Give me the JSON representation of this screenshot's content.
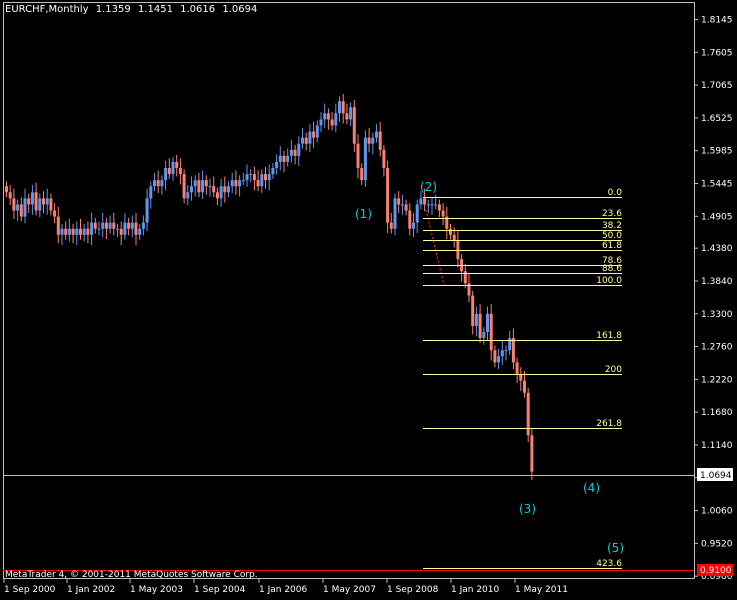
{
  "header": {
    "symbol_timeframe": "EURCHF,Monthly",
    "open": "1.1359",
    "high": "1.1451",
    "low": "1.0616",
    "close": "1.0694"
  },
  "copyright": "MetaTrader 4, © 2001-2011 MetaQuotes Software Corp.",
  "colors": {
    "background": "#000000",
    "bull_candle": "#6495ED",
    "bear_candle": "#FA8072",
    "fibo_line": "#FFFF99",
    "fibo_text": "#FFFF99",
    "wave_labels": "#00CED1",
    "price_marker_bg": "#FFFFFF",
    "alert_marker_bg": "#FF0000",
    "axis": "#C0C0C0"
  },
  "price_axis": {
    "ticks": [
      "1.8145",
      "1.7605",
      "1.7065",
      "1.6525",
      "1.5985",
      "1.5445",
      "1.4905",
      "1.4380",
      "1.3840",
      "1.3300",
      "1.2760",
      "1.2220",
      "1.1680",
      "1.1140",
      "1.0600",
      "1.0060",
      "0.9520",
      "0.8980"
    ],
    "current_price_label": "1.0694",
    "alert_price_label": "0.9100"
  },
  "time_axis": {
    "labels": [
      "1 Sep 2000",
      "1 Jan 2002",
      "1 May 2003",
      "1 Sep 2004",
      "1 Jan 2006",
      "1 May 2007",
      "1 Sep 2008",
      "1 Jan 2010",
      "1 May 2011"
    ]
  },
  "fibonacci": {
    "levels": [
      "0.0",
      "23.6",
      "38.2",
      "50.0",
      "61.8",
      "78.6",
      "88.6",
      "100.0",
      "161.8",
      "200",
      "261.8",
      "423.6"
    ]
  },
  "waves": {
    "labels": [
      "(1)",
      "(2)",
      "(3)",
      "(4)",
      "(5)"
    ]
  },
  "chart_data": {
    "type": "candlestick",
    "title": "EURCHF,Monthly",
    "ylim": [
      0.895,
      1.84
    ],
    "candles_close": [
      1.53,
      1.52,
      1.5,
      1.51,
      1.49,
      1.52,
      1.51,
      1.53,
      1.5,
      1.52,
      1.51,
      1.52,
      1.5,
      1.49,
      1.46,
      1.47,
      1.46,
      1.47,
      1.46,
      1.47,
      1.46,
      1.47,
      1.46,
      1.48,
      1.47,
      1.47,
      1.48,
      1.47,
      1.48,
      1.47,
      1.47,
      1.46,
      1.48,
      1.47,
      1.48,
      1.46,
      1.47,
      1.48,
      1.52,
      1.54,
      1.55,
      1.54,
      1.55,
      1.57,
      1.56,
      1.58,
      1.57,
      1.56,
      1.52,
      1.53,
      1.54,
      1.55,
      1.53,
      1.55,
      1.54,
      1.54,
      1.53,
      1.52,
      1.54,
      1.53,
      1.54,
      1.55,
      1.54,
      1.55,
      1.55,
      1.56,
      1.56,
      1.55,
      1.54,
      1.56,
      1.55,
      1.56,
      1.57,
      1.58,
      1.59,
      1.58,
      1.59,
      1.6,
      1.59,
      1.61,
      1.62,
      1.61,
      1.63,
      1.62,
      1.64,
      1.65,
      1.66,
      1.65,
      1.64,
      1.66,
      1.68,
      1.66,
      1.65,
      1.67,
      1.61,
      1.57,
      1.55,
      1.62,
      1.61,
      1.62,
      1.63,
      1.6,
      1.57,
      1.48,
      1.47,
      1.52,
      1.51,
      1.51,
      1.5,
      1.47,
      1.48,
      1.51,
      1.52,
      1.51,
      1.51,
      1.51,
      1.51,
      1.5,
      1.49,
      1.47,
      1.46,
      1.45,
      1.42,
      1.4,
      1.38,
      1.36,
      1.31,
      1.33,
      1.29,
      1.3,
      1.33,
      1.27,
      1.25,
      1.26,
      1.27,
      1.27,
      1.29,
      1.25,
      1.23,
      1.22,
      1.2,
      1.13,
      1.07
    ]
  }
}
